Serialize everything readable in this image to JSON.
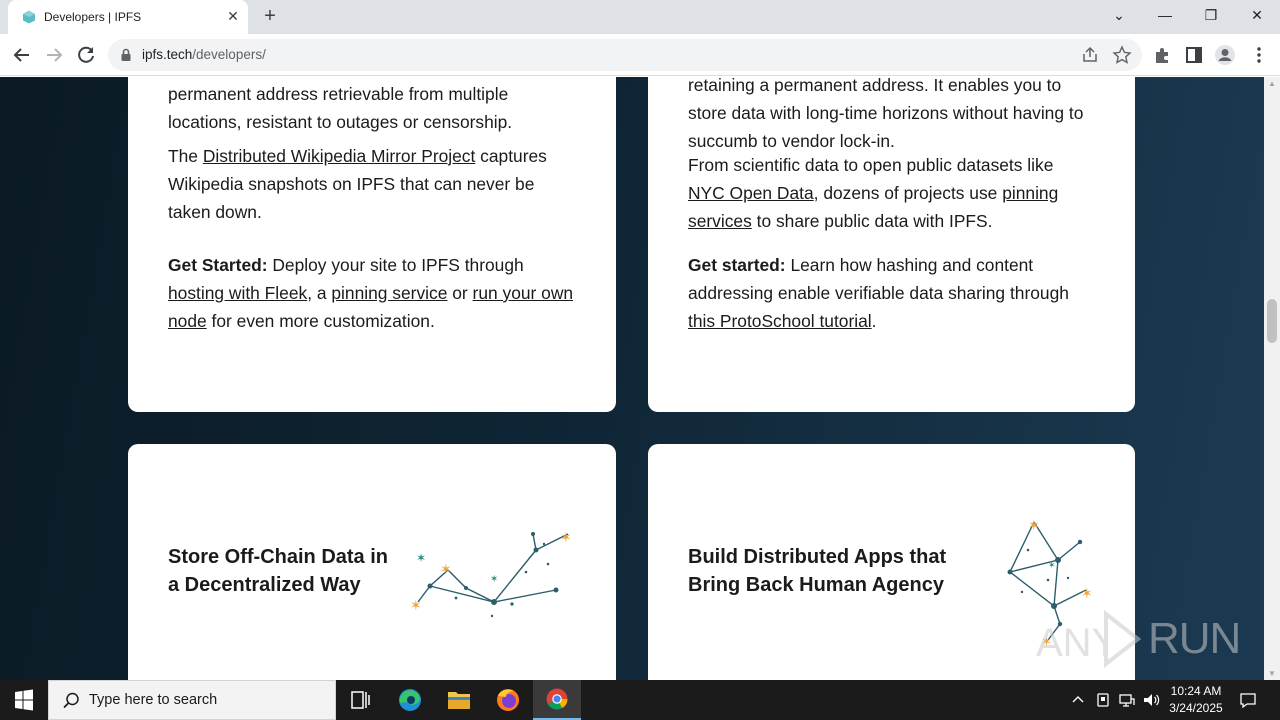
{
  "browser": {
    "tab_title": "Developers | IPFS",
    "tab_close": "✕",
    "new_tab": "+",
    "url_host": "ipfs.tech",
    "url_path": "/developers/",
    "window_controls": {
      "dropdown": "⌄",
      "minimize": "—",
      "restore": "❐",
      "close": "✕"
    }
  },
  "cards": {
    "top_left": {
      "para1": "permanent address retrievable from multiple locations, resistant to outages or censorship.",
      "para2_pre": "The ",
      "para2_link": "Distributed Wikipedia Mirror Project",
      "para2_post": " captures Wikipedia snapshots on IPFS that can never be taken down.",
      "get_started_label": "Get Started:",
      "gs_text1": " Deploy your site to IPFS through ",
      "gs_link1": "hosting with Fleek",
      "gs_text2": ", a ",
      "gs_link2": "pinning service",
      "gs_text3": " or ",
      "gs_link3": "run your own node",
      "gs_text4": " for even more customization."
    },
    "top_right": {
      "para1": "retaining a permanent address. It enables you to store data with long-time horizons without having to succumb to vendor lock-in.",
      "para2_pre": "From scientific data to open public datasets like ",
      "para2_link1": "NYC Open Data",
      "para2_mid": ", dozens of projects use ",
      "para2_link2": "pinning services",
      "para2_post": " to share public data with IPFS.",
      "get_started_label": "Get started:",
      "gs_text1": " Learn how hashing and content addressing enable verifiable data sharing through ",
      "gs_link1": "this ProtoSchool tutorial",
      "gs_text2": "."
    },
    "bottom_left": {
      "heading": "Store Off-Chain Data in a Decentralized Way"
    },
    "bottom_right": {
      "heading": "Build Distributed Apps that Bring Back Human Agency"
    }
  },
  "watermark": "RUN",
  "taskbar": {
    "search_placeholder": "Type here to search",
    "time": "10:24 AM",
    "date": "3/24/2025"
  },
  "colors": {
    "page_bg_dark": "#0b1a24",
    "page_bg_light": "#1b3a52",
    "card": "#ffffff",
    "accent_teal": "#2b5d6b",
    "accent_orange": "#f2a33a"
  }
}
